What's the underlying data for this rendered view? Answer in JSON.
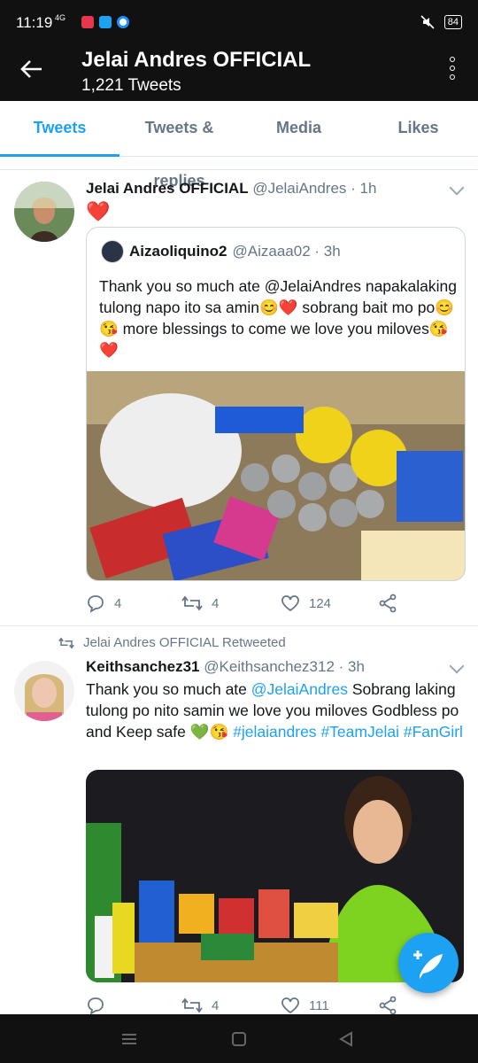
{
  "status": {
    "time": "11:19",
    "network": "4G",
    "battery": "84"
  },
  "header": {
    "title": "Jelai Andres OFFICIAL",
    "subtitle": "1,221 Tweets"
  },
  "tabs": [
    {
      "label": "Tweets",
      "active": true
    },
    {
      "label": "Tweets & replies"
    },
    {
      "label": "Media"
    },
    {
      "label": "Likes"
    }
  ],
  "tweet1": {
    "name": "Jelai Andres OFFICIAL",
    "meta": "@JelaiAndres · 1h",
    "text": "❤️",
    "quote": {
      "name": "Aizaoliquino2",
      "meta": "@Aizaaa02 · 3h",
      "text": "Thank you so much ate @JelaiAndres napakalaking tulong napo ito sa amin😊❤️ sobrang bait mo po😊😘 more blessings to come we love you miloves😘❤️"
    },
    "replies": "4",
    "retweets": "4",
    "likes": "124"
  },
  "tweet2": {
    "retweeted_by": "Jelai Andres OFFICIAL Retweeted",
    "name": "Keithsanchez31",
    "meta": "@Keithsanchez312 · 3h",
    "text_a": "Thank you so much ate ",
    "mention": "@JelaiAndres",
    "text_b": " Sobrang laking tulong po nito samin we love you miloves Godbless po and Keep safe 💚😘 ",
    "hashtag1": "#jelaiandres",
    "hashtag2": "#TeamJelai",
    "hashtag3": "#FanGirl",
    "replies": "",
    "retweets": "4",
    "likes": "111"
  },
  "colors": {
    "accent": "#1da1f2",
    "muted": "#657786",
    "heart": "#e0245e"
  }
}
